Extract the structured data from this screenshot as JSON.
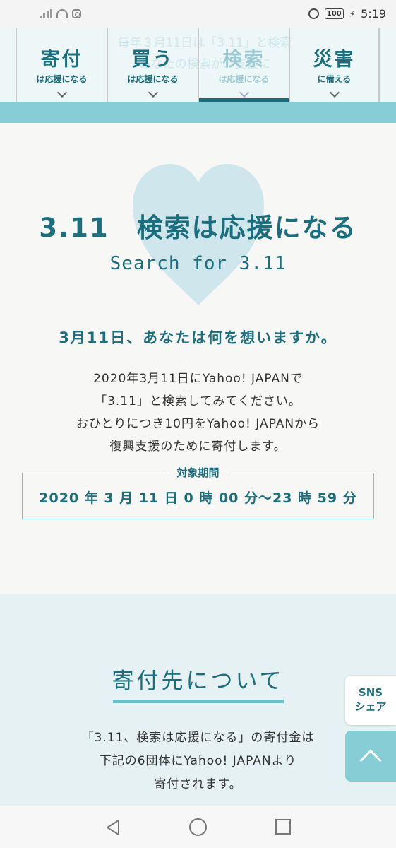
{
  "status_bar": {
    "time": "5:19",
    "battery": "100",
    "icons": [
      "signal-icon",
      "wifi-icon",
      "instagram-icon",
      "alarm-icon",
      "battery-icon",
      "charging-icon"
    ]
  },
  "nav": {
    "ghost_text_line1": "毎年３月11日は「3.11」と検索",
    "ghost_text_line2": "あなたの検索が、支援に",
    "items": [
      {
        "main": "寄付",
        "sub": "は応援になる",
        "active": false
      },
      {
        "main": "買う",
        "sub": "は応援になる",
        "active": false
      },
      {
        "main": "検索",
        "sub": "は応援になる",
        "active": true
      },
      {
        "main": "災害",
        "sub": "に備える",
        "active": false
      }
    ]
  },
  "hero": {
    "title": "3.11　検索は応援になる",
    "subtitle": "Search for 3.11",
    "question": "3月11日、あなたは何を想いますか。",
    "body_lines": [
      "2020年3月11日にYahoo! JAPANで",
      "「3.11」と検索してみてください。",
      "おひとりにつき10円をYahoo! JAPANから",
      "復興支援のために寄付します。"
    ],
    "period_label": "対象期間",
    "period_value": "2020 年 3 月 11 日 0 時 00 分〜23 時 59 分"
  },
  "donation": {
    "title": "寄付先について",
    "body_lines": [
      "「3.11、検索は応援になる」の寄付金は",
      "下記の6団体にYahoo! JAPANより",
      "寄付されます。"
    ]
  },
  "floating": {
    "sns_line1": "SNS",
    "sns_line2": "シェア"
  },
  "colors": {
    "accent": "#1b6e7e",
    "band": "#86cdd6",
    "heart": "#cfe7ec",
    "donation_bg": "#e5f1f2"
  }
}
